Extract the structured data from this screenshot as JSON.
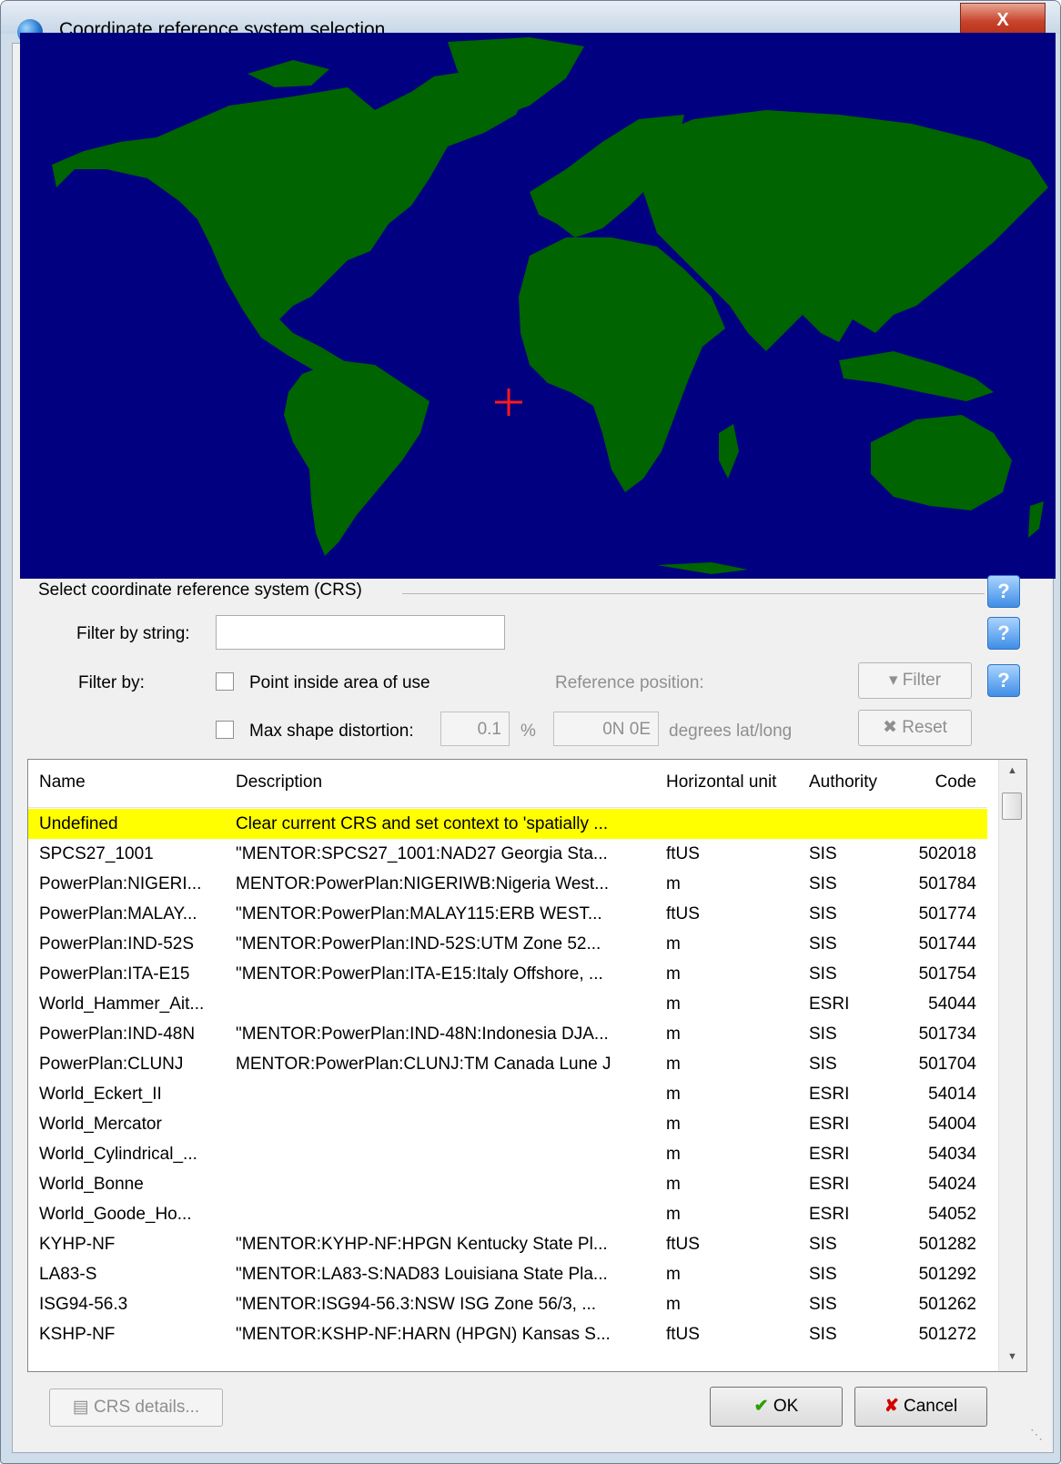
{
  "window": {
    "title": "Coordinate reference system selection",
    "close_label": "X"
  },
  "colors": {
    "ocean": "#000080",
    "land": "#006400",
    "marker": "#ff1a1a",
    "selected_row": "#ffff00"
  },
  "section": {
    "title": "Select coordinate reference system (CRS)",
    "help_label": "?"
  },
  "filter": {
    "string_label": "Filter by string:",
    "string_value": "",
    "by_label": "Filter by:",
    "point_inside_label": "Point inside area of use",
    "reference_position_label": "Reference position:",
    "max_distortion_label": "Max shape distortion:",
    "distortion_value": "0.1",
    "percent_label": "%",
    "position_value": "0N 0E",
    "degrees_label": "degrees lat/long",
    "filter_button": "Filter",
    "reset_button": "Reset"
  },
  "table": {
    "columns": [
      "Name",
      "Description",
      "Horizontal unit",
      "Authority",
      "Code"
    ],
    "rows": [
      {
        "name": "Undefined",
        "desc": "Clear current CRS and set context to 'spatially ...",
        "unit": "",
        "auth": "",
        "code": ""
      },
      {
        "name": "SPCS27_1001",
        "desc": "\"MENTOR:SPCS27_1001:NAD27 Georgia Sta...",
        "unit": "ftUS",
        "auth": "SIS",
        "code": "502018"
      },
      {
        "name": "PowerPlan:NIGERI...",
        "desc": "MENTOR:PowerPlan:NIGERIWB:Nigeria West...",
        "unit": "m",
        "auth": "SIS",
        "code": "501784"
      },
      {
        "name": "PowerPlan:MALAY...",
        "desc": "\"MENTOR:PowerPlan:MALAY115:ERB WEST...",
        "unit": "ftUS",
        "auth": "SIS",
        "code": "501774"
      },
      {
        "name": "PowerPlan:IND-52S",
        "desc": "\"MENTOR:PowerPlan:IND-52S:UTM Zone 52...",
        "unit": "m",
        "auth": "SIS",
        "code": "501744"
      },
      {
        "name": "PowerPlan:ITA-E15",
        "desc": "\"MENTOR:PowerPlan:ITA-E15:Italy Offshore, ...",
        "unit": "m",
        "auth": "SIS",
        "code": "501754"
      },
      {
        "name": "World_Hammer_Ait...",
        "desc": "",
        "unit": "m",
        "auth": "ESRI",
        "code": "54044"
      },
      {
        "name": "PowerPlan:IND-48N",
        "desc": "\"MENTOR:PowerPlan:IND-48N:Indonesia DJA...",
        "unit": "m",
        "auth": "SIS",
        "code": "501734"
      },
      {
        "name": "PowerPlan:CLUNJ",
        "desc": "MENTOR:PowerPlan:CLUNJ:TM Canada Lune J",
        "unit": "m",
        "auth": "SIS",
        "code": "501704"
      },
      {
        "name": "World_Eckert_II",
        "desc": "",
        "unit": "m",
        "auth": "ESRI",
        "code": "54014"
      },
      {
        "name": "World_Mercator",
        "desc": "",
        "unit": "m",
        "auth": "ESRI",
        "code": "54004"
      },
      {
        "name": "World_Cylindrical_...",
        "desc": "",
        "unit": "m",
        "auth": "ESRI",
        "code": "54034"
      },
      {
        "name": "World_Bonne",
        "desc": "",
        "unit": "m",
        "auth": "ESRI",
        "code": "54024"
      },
      {
        "name": "World_Goode_Ho...",
        "desc": "",
        "unit": "m",
        "auth": "ESRI",
        "code": "54052"
      },
      {
        "name": "KYHP-NF",
        "desc": "\"MENTOR:KYHP-NF:HPGN Kentucky State Pl...",
        "unit": "ftUS",
        "auth": "SIS",
        "code": "501282"
      },
      {
        "name": "LA83-S",
        "desc": "\"MENTOR:LA83-S:NAD83 Louisiana State Pla...",
        "unit": "m",
        "auth": "SIS",
        "code": "501292"
      },
      {
        "name": "ISG94-56.3",
        "desc": "\"MENTOR:ISG94-56.3:NSW ISG Zone 56/3, ...",
        "unit": "m",
        "auth": "SIS",
        "code": "501262"
      },
      {
        "name": "KSHP-NF",
        "desc": "\"MENTOR:KSHP-NF:HARN (HPGN) Kansas S...",
        "unit": "ftUS",
        "auth": "SIS",
        "code": "501272"
      }
    ]
  },
  "footer": {
    "details_button": "CRS details...",
    "ok_button": "OK",
    "cancel_button": "Cancel"
  }
}
